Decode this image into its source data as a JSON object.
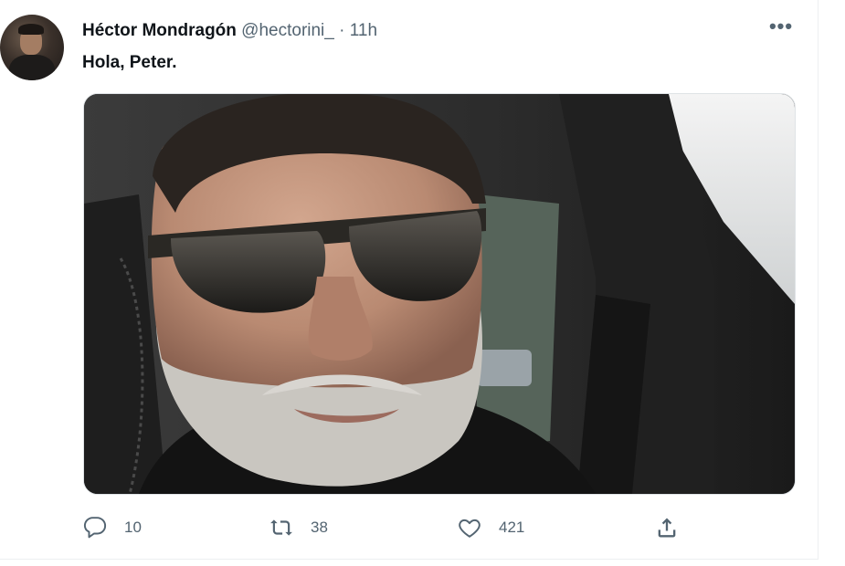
{
  "tweet": {
    "display_name": "Héctor Mondragón",
    "handle": "@hectorini_",
    "separator": "·",
    "time": "11h",
    "more_label": "•••",
    "text_part1": "Hola",
    "text_part2": ", ",
    "text_part3": "Peter",
    "text_part4": ".",
    "media_icon": "selfie-photo",
    "actions": {
      "reply": {
        "icon": "reply-icon",
        "count": "10"
      },
      "retweet": {
        "icon": "retweet-icon",
        "count": "38"
      },
      "like": {
        "icon": "heart-icon",
        "count": "421"
      },
      "share": {
        "icon": "share-icon"
      }
    }
  },
  "colors": {
    "text_primary": "#0f1419",
    "text_secondary": "#536471",
    "background": "#ffffff"
  }
}
